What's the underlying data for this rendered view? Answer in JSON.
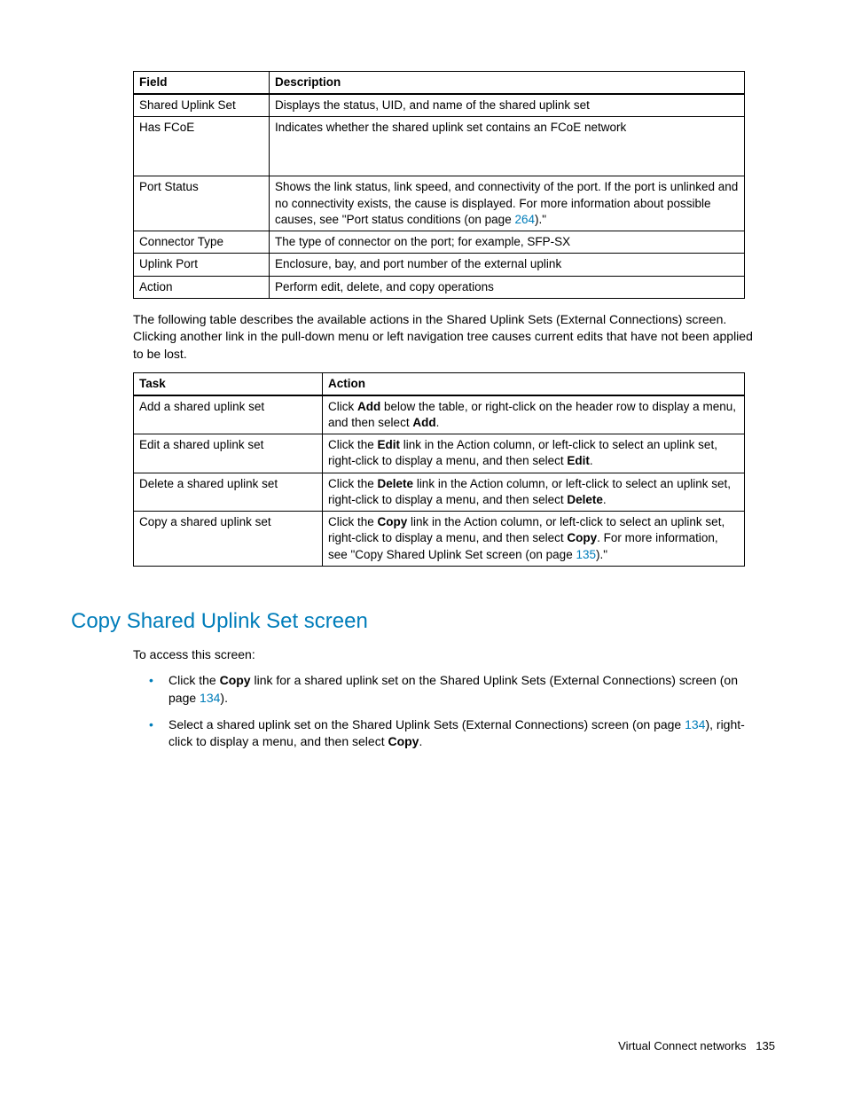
{
  "table1": {
    "headers": [
      "Field",
      "Description"
    ],
    "rows": [
      {
        "field": "Shared Uplink Set",
        "desc": "Displays the status, UID, and name of the shared uplink set"
      },
      {
        "field": "Has FCoE",
        "desc": "Indicates whether the shared uplink set contains an FCoE network",
        "tall": true
      },
      {
        "field": "Port Status",
        "desc_pre": "Shows the link status, link speed, and connectivity of the port. If the port is unlinked and no connectivity exists, the cause is displayed. For more information about possible causes, see \"Port status conditions (on page ",
        "desc_link": "264",
        "desc_post": ").\""
      },
      {
        "field": "Connector Type",
        "desc": "The type of connector on the port; for example, SFP-SX"
      },
      {
        "field": "Uplink Port",
        "desc": "Enclosure, bay, and port number of the external uplink"
      },
      {
        "field": "Action",
        "desc": "Perform edit, delete, and copy operations"
      }
    ]
  },
  "para1": "The following table describes the available actions in the Shared Uplink Sets (External Connections) screen. Clicking another link in the pull-down menu or left navigation tree causes current edits that have not been applied to be lost.",
  "table2": {
    "headers": [
      "Task",
      "Action"
    ],
    "rows": [
      {
        "task": "Add a shared uplink set",
        "parts": [
          {
            "t": "Click "
          },
          {
            "t": "Add",
            "b": true
          },
          {
            "t": " below the table, or right-click on the header row to display a menu, and then select "
          },
          {
            "t": "Add",
            "b": true
          },
          {
            "t": "."
          }
        ]
      },
      {
        "task": "Edit a shared uplink set",
        "parts": [
          {
            "t": "Click the "
          },
          {
            "t": "Edit",
            "b": true
          },
          {
            "t": " link in the Action column, or left-click to select an uplink set, right-click to display a menu, and then select "
          },
          {
            "t": "Edit",
            "b": true
          },
          {
            "t": "."
          }
        ]
      },
      {
        "task": "Delete a shared uplink set",
        "parts": [
          {
            "t": "Click the "
          },
          {
            "t": "Delete",
            "b": true
          },
          {
            "t": " link in the Action column, or left-click to select an uplink set, right-click to display a menu, and then select "
          },
          {
            "t": "Delete",
            "b": true
          },
          {
            "t": "."
          }
        ]
      },
      {
        "task": "Copy a shared uplink set",
        "parts": [
          {
            "t": "Click the "
          },
          {
            "t": "Copy",
            "b": true
          },
          {
            "t": " link in the Action column, or left-click to select an uplink set, right-click to display a menu, and then select "
          },
          {
            "t": "Copy",
            "b": true
          },
          {
            "t": ". For more information, see \"Copy Shared Uplink Set screen (on page "
          },
          {
            "t": "135",
            "link": true
          },
          {
            "t": ").\""
          }
        ]
      }
    ]
  },
  "heading": "Copy Shared Uplink Set screen",
  "intro": "To access this screen:",
  "bullets": [
    {
      "parts": [
        {
          "t": "Click the "
        },
        {
          "t": "Copy",
          "b": true
        },
        {
          "t": " link for a shared uplink set on the Shared Uplink Sets (External Connections) screen (on page "
        },
        {
          "t": "134",
          "link": true
        },
        {
          "t": ")."
        }
      ]
    },
    {
      "parts": [
        {
          "t": "Select a shared uplink set on the Shared Uplink Sets (External Connections) screen (on page "
        },
        {
          "t": "134",
          "link": true
        },
        {
          "t": "), right-click to display a menu, and then select "
        },
        {
          "t": "Copy",
          "b": true
        },
        {
          "t": "."
        }
      ]
    }
  ],
  "footer": {
    "section": "Virtual Connect networks",
    "page": "135"
  }
}
